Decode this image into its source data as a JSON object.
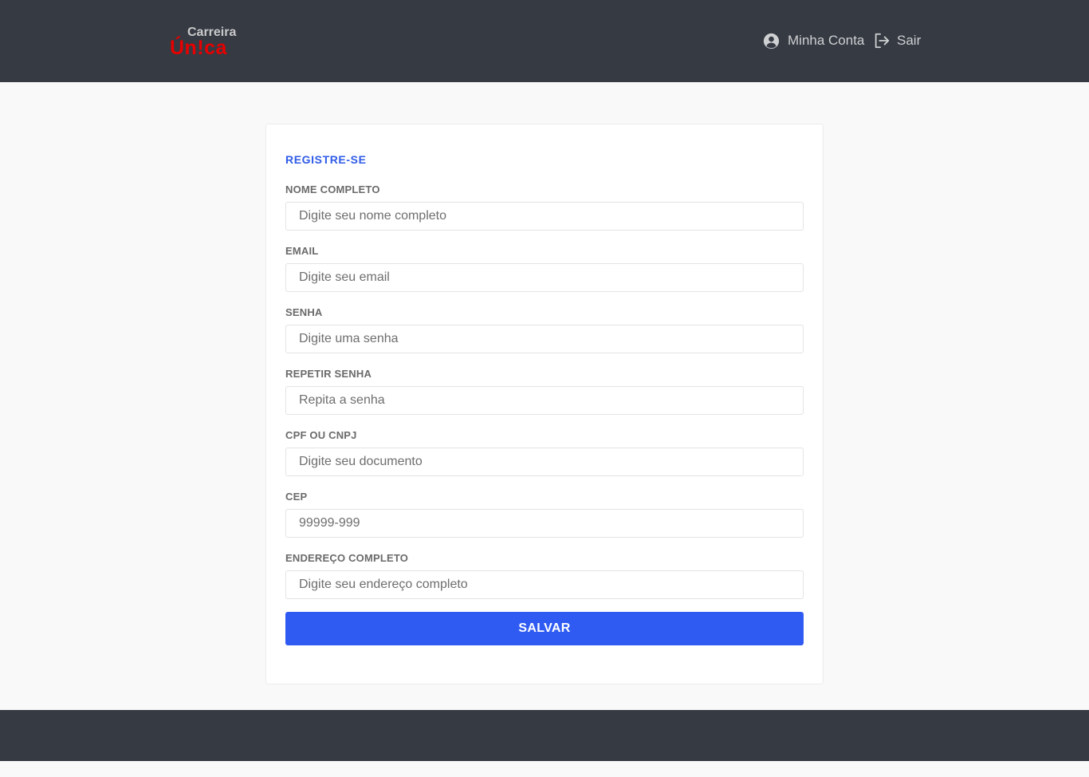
{
  "brand": {
    "line1": "Carreira",
    "line2": "Ún!ca"
  },
  "header": {
    "account_label": "Minha Conta",
    "account_icon": "user-circle-icon",
    "logout_label": "Sair",
    "logout_icon": "logout-icon"
  },
  "form": {
    "title": "REGISTRE-SE",
    "fields": [
      {
        "label": "NOME COMPLETO",
        "placeholder": "Digite seu nome completo",
        "value": ""
      },
      {
        "label": "EMAIL",
        "placeholder": "Digite seu email",
        "value": ""
      },
      {
        "label": "SENHA",
        "placeholder": "Digite uma senha",
        "value": ""
      },
      {
        "label": "REPETIR SENHA",
        "placeholder": "Repita a senha",
        "value": ""
      },
      {
        "label": "CPF OU CNPJ",
        "placeholder": "Digite seu documento",
        "value": ""
      },
      {
        "label": "CEP",
        "placeholder": "99999-999",
        "value": ""
      },
      {
        "label": "ENDEREÇO COMPLETO",
        "placeholder": "Digite seu endereço completo",
        "value": ""
      }
    ],
    "submit_label": "SALVAR"
  },
  "colors": {
    "header_bg": "#353a43",
    "accent": "#2f5bf3",
    "brand_red": "#e60000",
    "page_bg": "#f9f9f9"
  }
}
